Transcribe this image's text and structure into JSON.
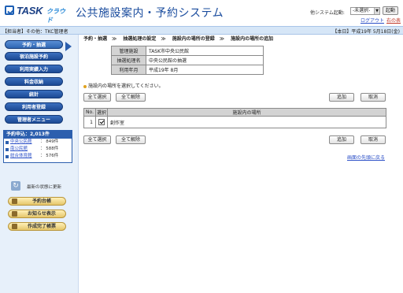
{
  "header": {
    "logo_text": "TASK",
    "logo_sub": "クラウド",
    "app_title": "公共施設案内・予約システム",
    "system_start_label": "他システム起動:",
    "system_select_value": "-未選択-",
    "start_button": "起動",
    "logout_link": "ログアウト",
    "help_link": "右の表"
  },
  "userbar": {
    "user": "【担当者】その他：TKC管理者",
    "date": "【本日】平成19年 5月18日(金)"
  },
  "sidebar": {
    "nav": [
      {
        "label": "予約・抽選"
      },
      {
        "label": "宿泊施設予約"
      },
      {
        "label": "利用実績入力"
      },
      {
        "label": "料金収納"
      },
      {
        "label": "統計"
      },
      {
        "label": "利用者登録"
      },
      {
        "label": "管理者メニュー"
      }
    ],
    "applications": {
      "title": "予約申込：2,013件",
      "rows": [
        {
          "name": "中央公民館",
          "count": "： 849件"
        },
        {
          "name": "南公民館",
          "count": "： 588件"
        },
        {
          "name": "総合体育館",
          "count": "： 576件"
        }
      ]
    },
    "refresh_label": "最新の状態に更新",
    "actions": [
      {
        "label": "予約台帳"
      },
      {
        "label": "お知らせ表示"
      },
      {
        "label": "作成完了帳票"
      }
    ]
  },
  "breadcrumb": {
    "items": [
      "予約・抽選",
      "抽選処理の設定",
      "施設内の場所の登録",
      "施設内の場所の追加"
    ],
    "separator": "≫"
  },
  "info": {
    "rows": [
      {
        "key": "管理施設",
        "value": "TASK市中央公民館"
      },
      {
        "key": "抽選処理名",
        "value": "中央公民館の抽選"
      },
      {
        "key": "利用年月",
        "value": "平成19年 8月"
      }
    ]
  },
  "note": "施設内の場所を選択してください。",
  "buttons": {
    "select_all": "全て選択",
    "clear_all": "全て解除",
    "add": "追加",
    "cancel": "取消"
  },
  "list": {
    "headers": {
      "no": "No.",
      "select": "選択",
      "place": "施設内の場所"
    },
    "rows": [
      {
        "no": "1",
        "checked": true,
        "place": "創作室"
      }
    ]
  },
  "top_link": "画面の先頭に戻る"
}
